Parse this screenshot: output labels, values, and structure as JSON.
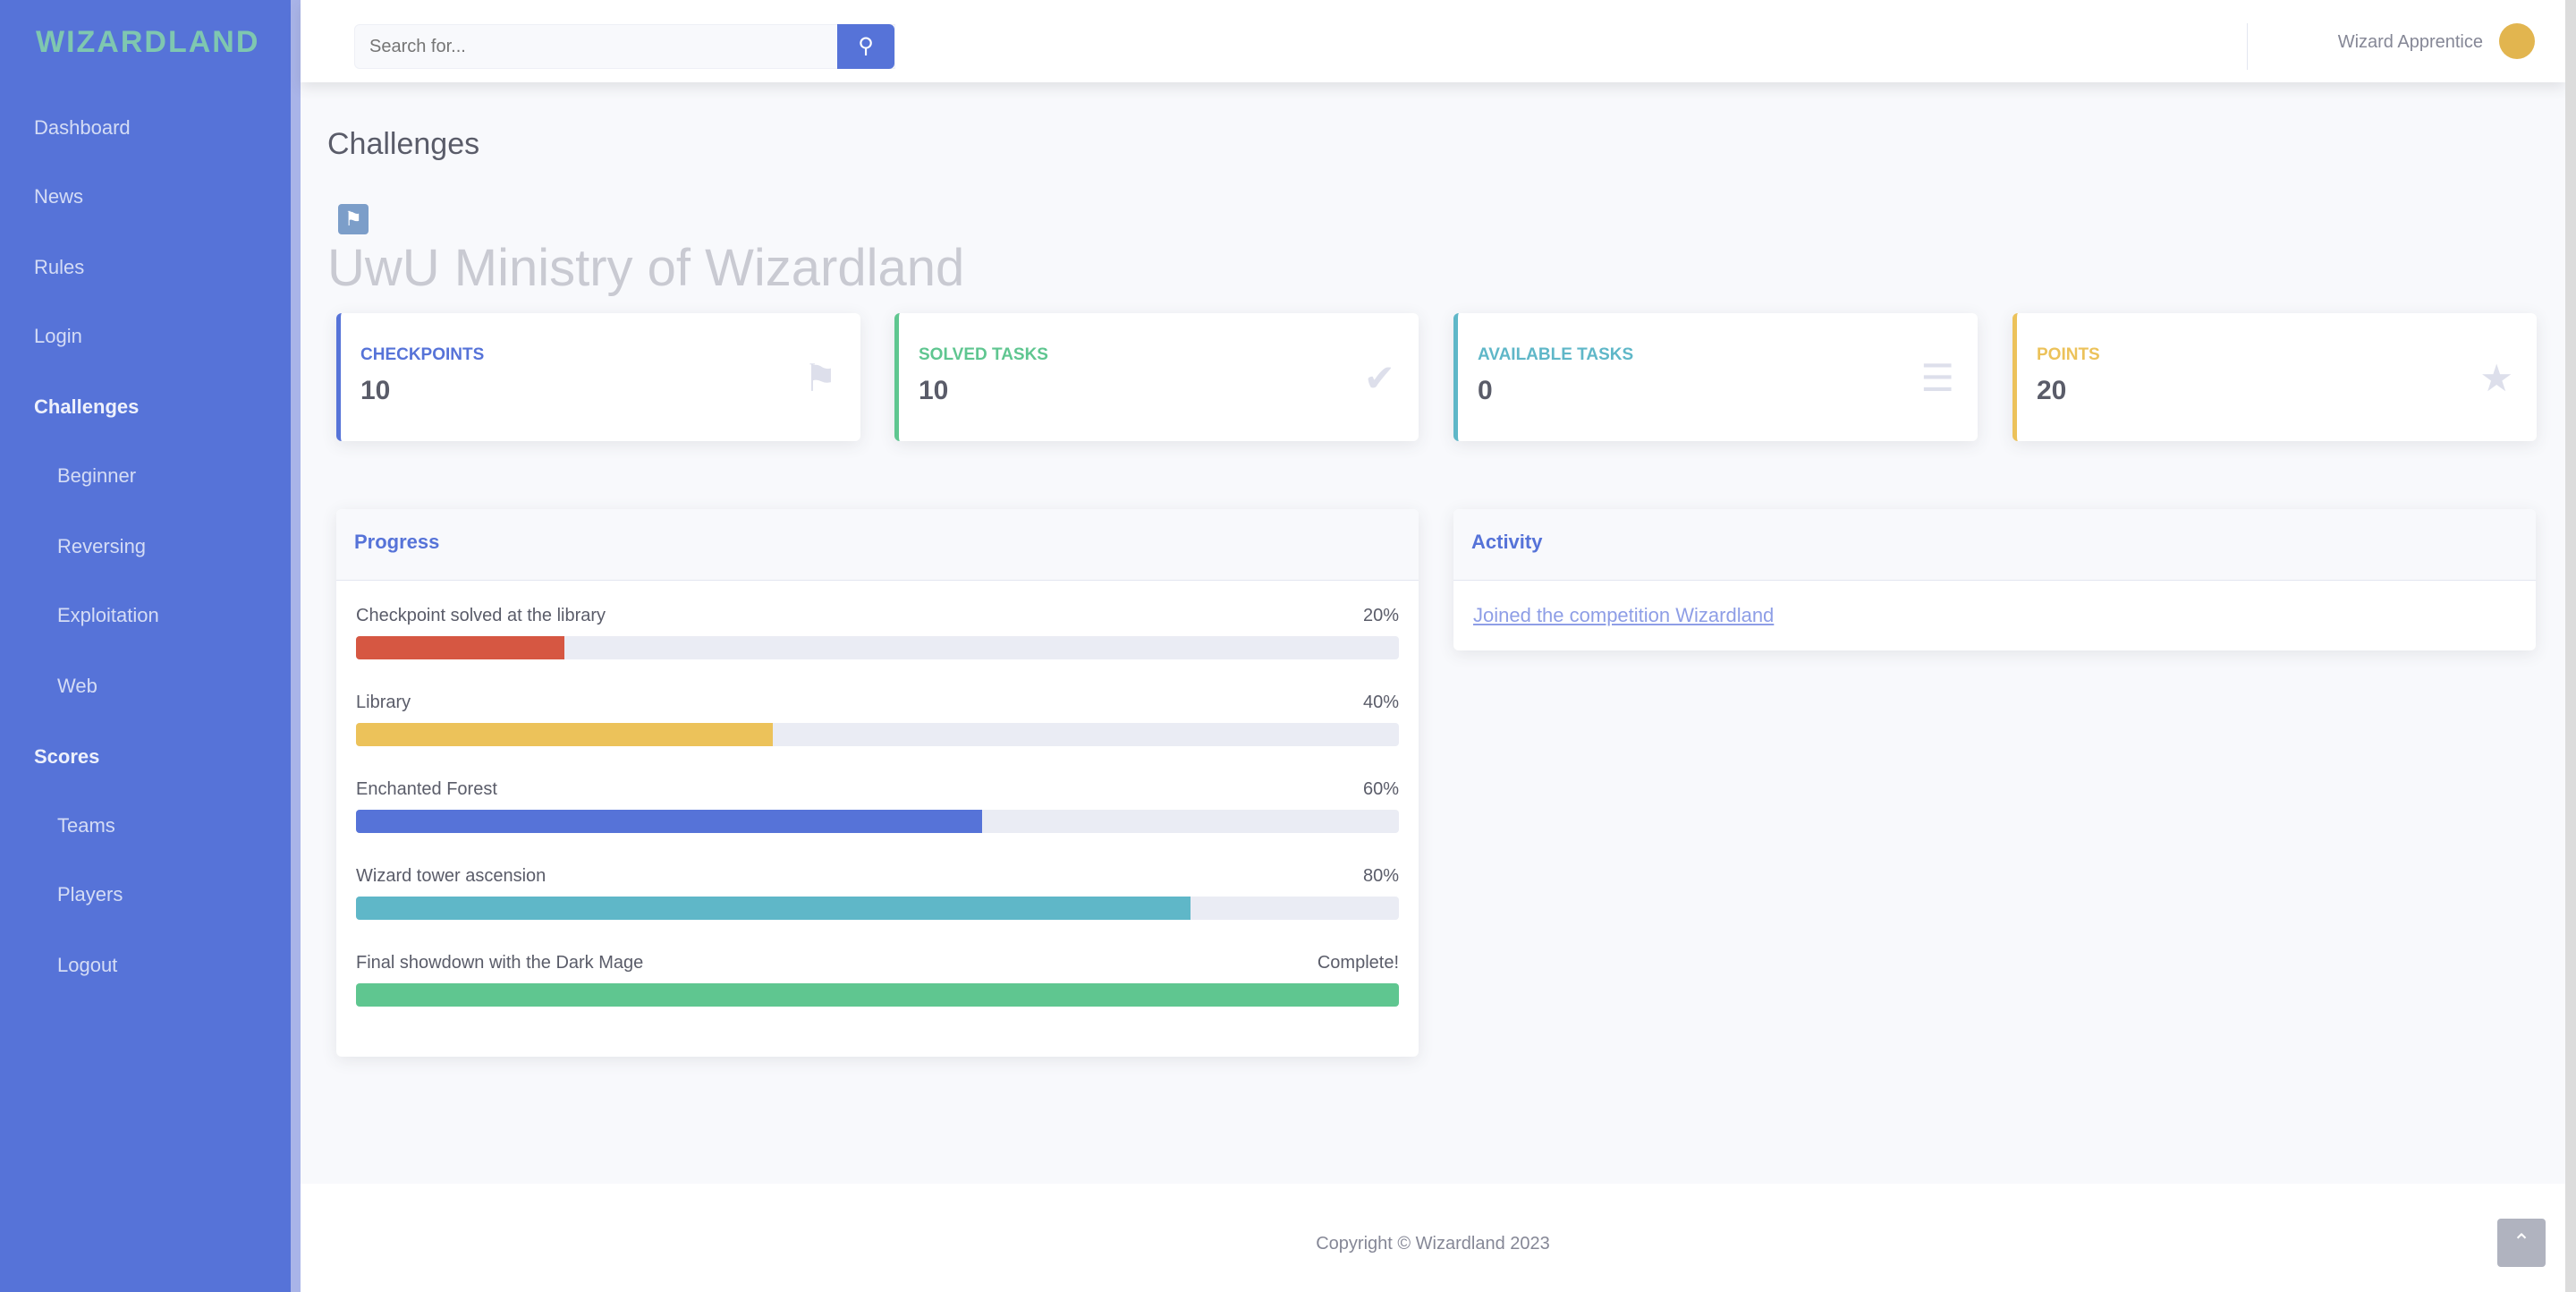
{
  "sidebar": {
    "brand": "WIZARDLAND",
    "items": [
      {
        "label": "Dashboard",
        "kind": "top"
      },
      {
        "label": "News",
        "kind": "top"
      },
      {
        "label": "Rules",
        "kind": "top"
      },
      {
        "label": "Login",
        "kind": "top"
      },
      {
        "label": "Challenges",
        "kind": "head"
      },
      {
        "label": "Beginner",
        "kind": "sub"
      },
      {
        "label": "Reversing",
        "kind": "sub"
      },
      {
        "label": "Exploitation",
        "kind": "sub"
      },
      {
        "label": "Web",
        "kind": "sub"
      },
      {
        "label": "Scores",
        "kind": "head"
      },
      {
        "label": "Teams",
        "kind": "sub"
      },
      {
        "label": "Players",
        "kind": "sub"
      },
      {
        "label": "Logout",
        "kind": "sub"
      }
    ]
  },
  "topbar": {
    "search_placeholder": "Search for...",
    "search_icon": "search-icon",
    "user_name": "Wizard Apprentice"
  },
  "page": {
    "heading": "Challenges",
    "title": "UwU Ministry of Wizardland"
  },
  "stats": [
    {
      "label": "Checkpoints",
      "value": "10",
      "color": "#5673d8",
      "icon": "flag-icon"
    },
    {
      "label": "Solved tasks",
      "value": "10",
      "color": "#5fc690",
      "icon": "check-icon"
    },
    {
      "label": "Available tasks",
      "value": "0",
      "color": "#5fb7c8",
      "icon": "list-icon"
    },
    {
      "label": "Points",
      "value": "20",
      "color": "#ecc25a",
      "icon": "star-icon"
    }
  ],
  "progress": {
    "title": "Progress",
    "items": [
      {
        "label": "Checkpoint solved at the library",
        "value": "20%",
        "percent": 20,
        "color": "#d65742"
      },
      {
        "label": "Library",
        "value": "40%",
        "percent": 40,
        "color": "#ecc25a"
      },
      {
        "label": "Enchanted Forest",
        "value": "60%",
        "percent": 60,
        "color": "#5673d8"
      },
      {
        "label": "Wizard tower ascension",
        "value": "80%",
        "percent": 80,
        "color": "#5fb7c8"
      },
      {
        "label": "Final showdown with the Dark Mage",
        "value": "Complete!",
        "percent": 100,
        "color": "#5fc690"
      }
    ]
  },
  "activity": {
    "title": "Activity",
    "link": "Joined the competition Wizardland"
  },
  "footer": {
    "copyright": "Copyright © Wizardland 2023"
  }
}
